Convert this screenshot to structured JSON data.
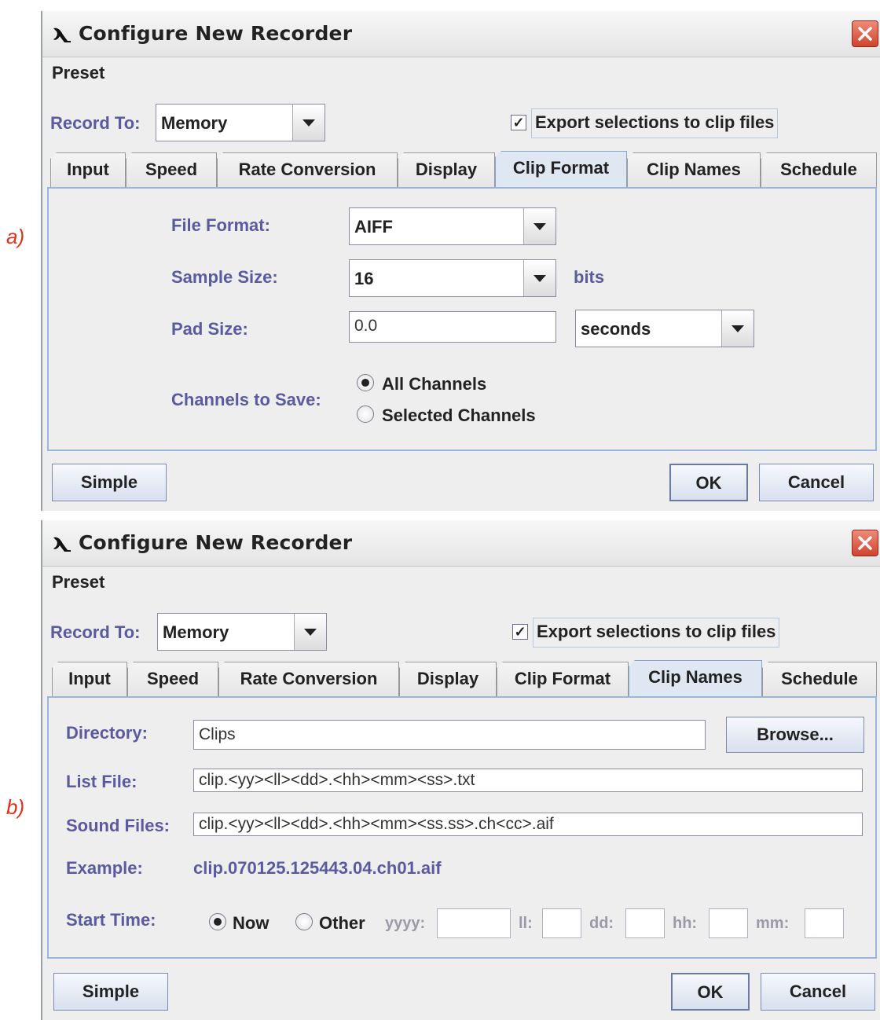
{
  "panel_a": {
    "letter": "a)",
    "title": "Configure New Recorder",
    "preset": "Preset",
    "record_to_label": "Record To:",
    "record_to_value": "Memory",
    "export_checked": "✓",
    "export_label": "Export selections to clip files",
    "tabs": [
      "Input",
      "Speed",
      "Rate Conversion",
      "Display",
      "Clip Format",
      "Clip Names",
      "Schedule"
    ],
    "active_tab": "Clip Format",
    "file_format_label": "File Format:",
    "file_format_value": "AIFF",
    "sample_size_label": "Sample Size:",
    "sample_size_value": "16",
    "sample_size_unit": "bits",
    "pad_size_label": "Pad Size:",
    "pad_size_value": "0.0",
    "pad_unit_value": "seconds",
    "channels_label": "Channels to Save:",
    "radio_all": "All Channels",
    "radio_selected": "Selected Channels",
    "simple": "Simple",
    "ok": "OK",
    "cancel": "Cancel"
  },
  "panel_b": {
    "letter": "b)",
    "title": "Configure New Recorder",
    "preset": "Preset",
    "record_to_label": "Record To:",
    "record_to_value": "Memory",
    "export_checked": "✓",
    "export_label": "Export selections to clip files",
    "tabs": [
      "Input",
      "Speed",
      "Rate Conversion",
      "Display",
      "Clip Format",
      "Clip Names",
      "Schedule"
    ],
    "active_tab": "Clip Names",
    "directory_label": "Directory:",
    "directory_value": "Clips",
    "browse": "Browse...",
    "list_file_label": "List File:",
    "list_file_value": "clip.<yy><ll><dd>.<hh><mm><ss>.txt",
    "sound_files_label": "Sound Files:",
    "sound_files_value": "clip.<yy><ll><dd>.<hh><mm><ss.ss>.ch<cc>.aif",
    "example_label": "Example:",
    "example_value": "clip.070125.125443.04.ch01.aif",
    "start_time_label": "Start Time:",
    "radio_now": "Now",
    "radio_other": "Other",
    "yyyy": "yyyy:",
    "ll": "ll:",
    "dd": "dd:",
    "hh": "hh:",
    "mm": "mm:",
    "simple": "Simple",
    "ok": "OK",
    "cancel": "Cancel"
  },
  "icons": {
    "app": "recorder-bird-icon",
    "close": "close-icon",
    "dropdown": "chevron-down-icon",
    "checkbox": "checkmark-icon"
  },
  "colors": {
    "label_blue": "#5a5aa0",
    "tab_active": "#dfe7f3",
    "content_border": "#9bb6dc",
    "close_red": "#d0452e",
    "letter_red": "#e0301e"
  }
}
